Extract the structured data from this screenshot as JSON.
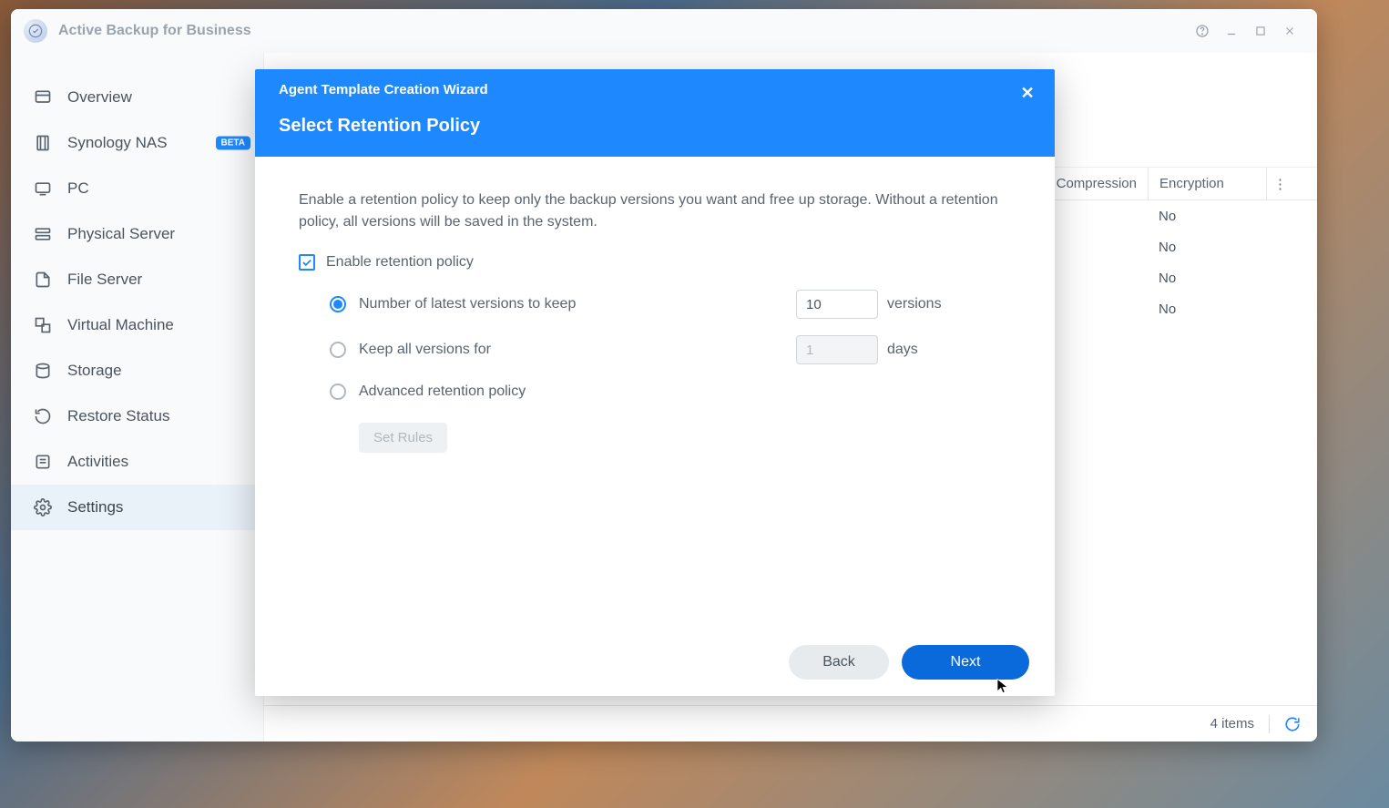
{
  "app": {
    "title": "Active Backup for Business"
  },
  "sidebar": {
    "items": [
      {
        "label": "Overview",
        "icon": "overview"
      },
      {
        "label": "Synology NAS",
        "icon": "nas",
        "badge": "BETA"
      },
      {
        "label": "PC",
        "icon": "pc"
      },
      {
        "label": "Physical Server",
        "icon": "pserver"
      },
      {
        "label": "File Server",
        "icon": "fserver"
      },
      {
        "label": "Virtual Machine",
        "icon": "vm"
      },
      {
        "label": "Storage",
        "icon": "storage"
      },
      {
        "label": "Restore Status",
        "icon": "restore"
      },
      {
        "label": "Activities",
        "icon": "activities"
      },
      {
        "label": "Settings",
        "icon": "settings",
        "active": true
      }
    ]
  },
  "table": {
    "headers": {
      "compression": "Compression",
      "encryption": "Encryption"
    },
    "rows": [
      {
        "encryption": "No"
      },
      {
        "encryption": "No"
      },
      {
        "encryption": "No"
      },
      {
        "encryption": "No"
      }
    ]
  },
  "statusbar": {
    "count": "4 items"
  },
  "modal": {
    "title": "Agent Template Creation Wizard",
    "subtitle": "Select Retention Policy",
    "description": "Enable a retention policy to keep only the backup versions you want and free up storage. Without a retention policy, all versions will be saved in the system.",
    "enableLabel": "Enable retention policy",
    "opt1": {
      "label": "Number of latest versions to keep",
      "value": "10",
      "unit": "versions"
    },
    "opt2": {
      "label": "Keep all versions for",
      "value": "1",
      "unit": "days"
    },
    "opt3": {
      "label": "Advanced retention policy"
    },
    "setRules": "Set Rules",
    "back": "Back",
    "next": "Next"
  }
}
